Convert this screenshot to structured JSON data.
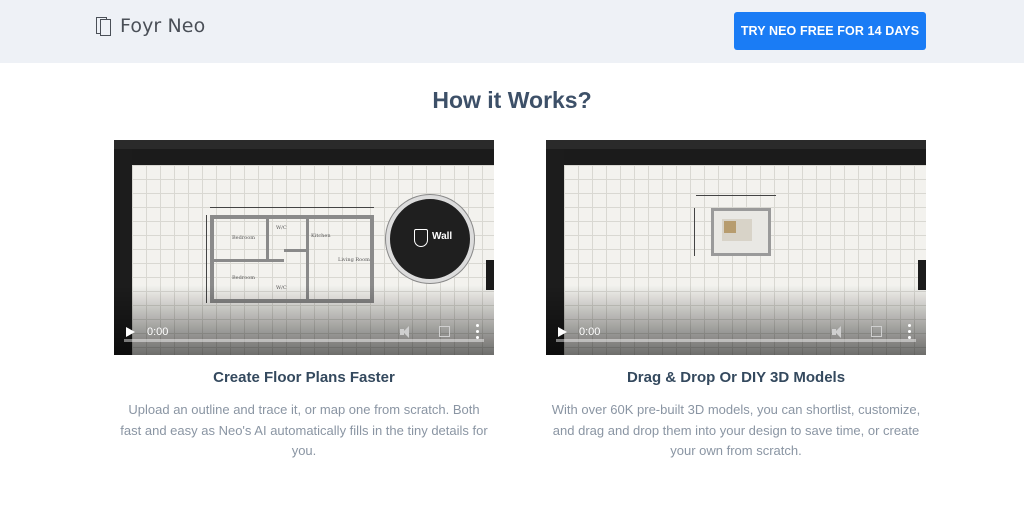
{
  "header": {
    "brand": "Foyr Neo",
    "cta_label": "TRY NEO FREE FOR 14 DAYS"
  },
  "section": {
    "title": "How it Works?"
  },
  "cards": [
    {
      "title": "Create Floor Plans Faster",
      "description": "Upload an outline and trace it, or map one from scratch. Both fast and easy as Neo's AI automatically fills in the tiny details for you.",
      "video": {
        "time": "0:00",
        "overlay_label": "Wall"
      }
    },
    {
      "title": "Drag & Drop Or DIY 3D Models",
      "description": "With over 60K pre-built 3D models, you can shortlist, customize, and drag and drop them into your design to save time, or create your own from scratch.",
      "video": {
        "time": "0:00"
      }
    }
  ],
  "colors": {
    "header_bg": "#eef1f6",
    "cta_bg": "#1a7cf5",
    "title_color": "#3d5068",
    "desc_color": "#8a95a3"
  }
}
